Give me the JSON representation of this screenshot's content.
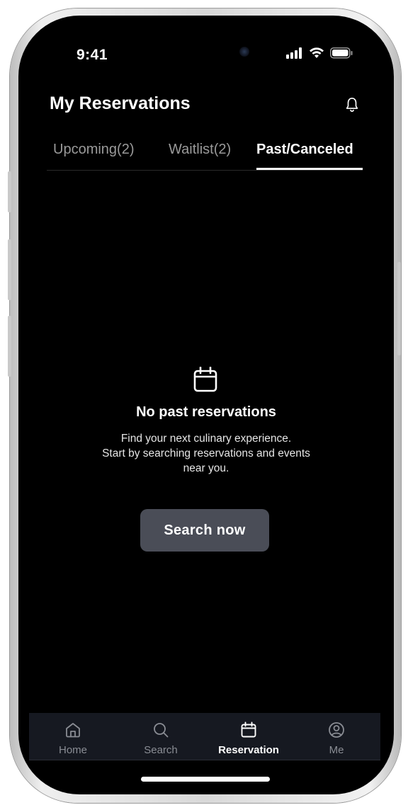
{
  "status_bar": {
    "time": "9:41"
  },
  "header": {
    "title": "My Reservations"
  },
  "tabs": [
    {
      "label": "Upcoming(2)",
      "active": false
    },
    {
      "label": "Waitlist(2)",
      "active": false
    },
    {
      "label": "Past/Canceled",
      "active": true
    }
  ],
  "empty_state": {
    "icon": "calendar-icon",
    "title": "No past reservations",
    "description_line1": "Find your next culinary experience.",
    "description_line2": "Start by searching reservations and events",
    "description_line3": "near you.",
    "button_label": "Search now"
  },
  "bottom_nav": {
    "items": [
      {
        "label": "Home",
        "icon": "home-icon",
        "active": false
      },
      {
        "label": "Search",
        "icon": "search-icon",
        "active": false
      },
      {
        "label": "Reservation",
        "icon": "calendar-icon",
        "active": true
      },
      {
        "label": "Me",
        "icon": "user-circle-icon",
        "active": false
      }
    ]
  },
  "colors": {
    "background": "#000000",
    "button_bg": "#4a4d57",
    "nav_bg": "#161921",
    "inactive_text": "#9a9a9a"
  }
}
